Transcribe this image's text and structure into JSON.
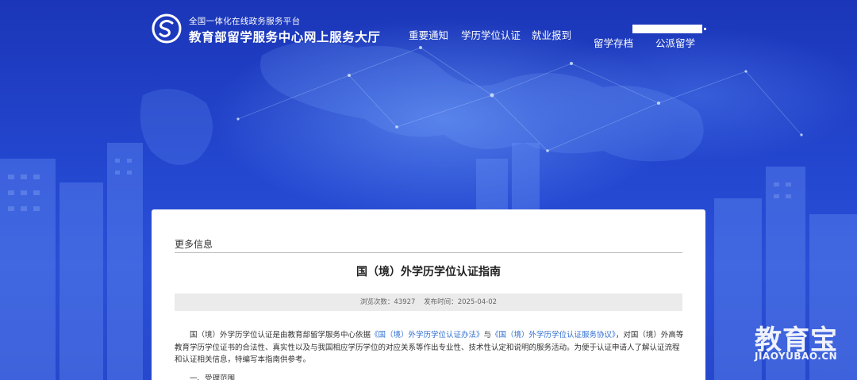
{
  "header": {
    "subtitle": "全国一体化在线政务服务平台",
    "title": "教育部留学服务中心网上服务大厅",
    "logo_icon": "circle-s-logo-icon"
  },
  "nav": {
    "items": [
      {
        "label": "重要通知"
      },
      {
        "label": "学历学位认证"
      },
      {
        "label": "就业报到"
      },
      {
        "label": "留学存档"
      },
      {
        "label": "公派留学"
      }
    ]
  },
  "card": {
    "section_label": "更多信息",
    "title": "国（境）外学历学位认证指南",
    "meta": {
      "views_label": "浏览次数：",
      "views": "43927",
      "date_label": "发布时间：",
      "date": "2025-04-02"
    },
    "paragraph": {
      "part1": "国（境）外学历学位认证是由教育部留学服务中心依据",
      "link1": "《国（境）外学历学位认证办法》",
      "part2": "与",
      "link2": "《国（境）外学历学位认证服务协议》",
      "part3": "，对国（境）外高等教育学历学位证书的合法性、真实性以及与我国相应学历学位的对应关系等作出专业性、技术性认定和说明的服务活动。为便于认证申请人了解认证流程和认证相关信息，特编写本指南供参考。"
    },
    "section_heading": "一、受理范围"
  },
  "watermark": {
    "cn": "教育宝",
    "en": "JIAOYUBAO.CN"
  },
  "colors": {
    "background_blue": "#2447d0",
    "link_blue": "#2f6ed1",
    "meta_bar": "#ebebeb"
  }
}
